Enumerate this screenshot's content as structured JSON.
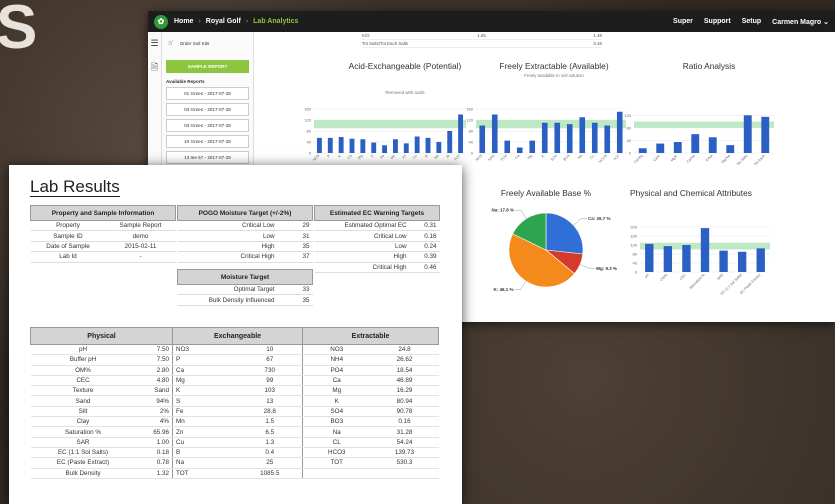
{
  "colors": {
    "accent": "#8cc63f",
    "bar": "#2b5fc4",
    "band": "#bfe8c4",
    "pie_blue": "#2f6fd6",
    "pie_orange": "#f48a1c",
    "pie_green": "#2da44e",
    "pie_red": "#d63a2a"
  },
  "background_letter": "S",
  "nav": {
    "crumbs": [
      "Home",
      "Royal Golf",
      "Lab Analytics"
    ],
    "links": [
      "Super",
      "Support",
      "Setup"
    ],
    "user": "Carmen Magro"
  },
  "sidebar": {
    "order_kits": "Order Soil Kits",
    "sample_report": "SAMPLE REPORT",
    "available_title": "Available Reports",
    "reports": [
      "01 Green - 2017-07-28",
      "03 Green - 2017-07-28",
      "03 Green - 2017-07-28",
      "10 Green - 2017-07-28",
      "13 tee 57 - 2017-07-28"
    ]
  },
  "top_table": [
    {
      "label": "K/O",
      "v1": "1.05",
      "v2": "1.48"
    },
    {
      "label": "Tot Salts/Tot Each Salts",
      "v1": "",
      "v2": "0.46"
    }
  ],
  "chart_data": [
    {
      "type": "bar",
      "title": "Acid-Exchangeable (Potential)",
      "subtitle": "Removed with acids",
      "yticks": [
        "160",
        "120",
        "80",
        "40",
        "0"
      ],
      "ylim": [
        0,
        160
      ],
      "band": [
        90,
        120
      ],
      "categories": [
        "NO3",
        "P",
        "K",
        "Ca",
        "Mg",
        "S",
        "Fe",
        "Mn",
        "Zn",
        "Cu",
        "B",
        "Na",
        "Al",
        "TOT"
      ],
      "values": [
        55,
        55,
        58,
        52,
        50,
        38,
        28,
        50,
        35,
        60,
        55,
        40,
        80,
        140
      ]
    },
    {
      "type": "bar",
      "title": "Freely Extractable (Available)",
      "subtitle": "Freely available in soil solution",
      "yticks": [
        "160",
        "120",
        "80",
        "40",
        "0"
      ],
      "ylim": [
        0,
        160
      ],
      "band": [
        90,
        120
      ],
      "categories": [
        "NO3",
        "NH4",
        "PO4",
        "Ca",
        "Mg",
        "K",
        "SO4",
        "BO3",
        "Na",
        "CL",
        "HCO3",
        "TOT"
      ],
      "values": [
        100,
        140,
        45,
        20,
        45,
        110,
        110,
        105,
        130,
        110,
        100,
        150
      ]
    },
    {
      "type": "bar",
      "title": "Ratio Analysis",
      "subtitle": "",
      "yticks": [
        "120",
        "80",
        "40",
        "0"
      ],
      "ylim": [
        0,
        140
      ],
      "band": [
        80,
        100
      ],
      "categories": [
        "Ca/Mg",
        "Ca/K",
        "Mg/K",
        "Ca/Na",
        "K/Na",
        "Mg/Na",
        "Tot Salts",
        "Tot Each"
      ],
      "values": [
        15,
        30,
        35,
        60,
        50,
        25,
        120,
        115
      ]
    },
    {
      "type": "pie",
      "title": "Freely Available Base %",
      "categories": [
        "Ca",
        "Mg",
        "K",
        "Na"
      ],
      "labels": [
        "Ca: 26.7 %",
        "Mg: 9.3 %",
        "K: 46.1 %",
        "Na: 17.8 %"
      ],
      "values": [
        26.7,
        9.3,
        46.1,
        17.8
      ]
    },
    {
      "type": "bar",
      "title": "Physical and Chemical Attributes",
      "subtitle": "",
      "yticks": [
        "200",
        "160",
        "120",
        "80",
        "40",
        "0"
      ],
      "ylim": [
        0,
        200
      ],
      "band": [
        100,
        130
      ],
      "categories": [
        "pH",
        "OM%",
        "CEC",
        "Saturation %",
        "SAR",
        "EC (1:1 Sol Salts)",
        "EC Paste Extract"
      ],
      "values": [
        125,
        115,
        120,
        195,
        95,
        90,
        105
      ]
    }
  ],
  "sheet": {
    "title": "Lab Results",
    "prop_header": "Property and Sample Information",
    "prop_rows": [
      [
        "Property",
        "Sample Report"
      ],
      [
        "Sample ID",
        "demo"
      ],
      [
        "Date of Sample",
        "2015-02-11"
      ],
      [
        "Lab Id",
        "-"
      ]
    ],
    "pogo_header": "POGO Moisture Target (+/-2%)",
    "pogo_rows": [
      [
        "Critical Low",
        "29"
      ],
      [
        "Low",
        "31"
      ],
      [
        "High",
        "35"
      ],
      [
        "Critical High",
        "37"
      ]
    ],
    "moisture_header": "Moisture Target",
    "moisture_rows": [
      [
        "Optimal Target",
        "33"
      ],
      [
        "Bulk Density Influenced",
        "35"
      ]
    ],
    "ec_header": "Estimated EC Warning Targets",
    "ec_rows": [
      [
        "Estimated Optimal EC",
        "0.31"
      ],
      [
        "Critical Low",
        "0.16"
      ],
      [
        "Low",
        "0.24"
      ],
      [
        "High",
        "0.39"
      ],
      [
        "Critical High",
        "0.46"
      ]
    ],
    "physical_header": "Physical",
    "exchangeable_header": "Exchangeable",
    "extractable_header": "Extractable",
    "physical": [
      [
        "pH",
        "7.50"
      ],
      [
        "Buffer pH",
        "7.50"
      ],
      [
        "OM%",
        "2.80"
      ],
      [
        "CEC",
        "4.80"
      ],
      [
        "Texture",
        "Sand"
      ],
      [
        "Sand",
        "94%"
      ],
      [
        "Silt",
        "2%"
      ],
      [
        "Clay",
        "4%"
      ],
      [
        "Saturation %",
        "65.96"
      ],
      [
        "SAR",
        "1.00"
      ],
      [
        "EC (1:1 Sol Salts)",
        "0.18"
      ],
      [
        "EC (Paste Extract)",
        "0.78"
      ],
      [
        "Bulk Density",
        "1.32"
      ]
    ],
    "exchangeable": [
      [
        "NO3",
        "10"
      ],
      [
        "P",
        "67"
      ],
      [
        "Ca",
        "730"
      ],
      [
        "Mg",
        "99"
      ],
      [
        "K",
        "103"
      ],
      [
        "S",
        "13"
      ],
      [
        "Fe",
        "28.8"
      ],
      [
        "Mn",
        "1.5"
      ],
      [
        "Zn",
        "6.5"
      ],
      [
        "Cu",
        "1.3"
      ],
      [
        "B",
        "0.4"
      ],
      [
        "Na",
        "25"
      ],
      [
        "TOT",
        "1085.5"
      ]
    ],
    "extractable": [
      [
        "NO3",
        "24.8"
      ],
      [
        "NH4",
        "26.62"
      ],
      [
        "PO4",
        "18.54"
      ],
      [
        "Ca",
        "46.89"
      ],
      [
        "Mg",
        "16.29"
      ],
      [
        "K",
        "80.94"
      ],
      [
        "SO4",
        "90.78"
      ],
      [
        "BO3",
        "0.16"
      ],
      [
        "Na",
        "31.28"
      ],
      [
        "CL",
        "54.24"
      ],
      [
        "HCO3",
        "139.73"
      ],
      [
        "TOT",
        "530.3"
      ]
    ]
  }
}
